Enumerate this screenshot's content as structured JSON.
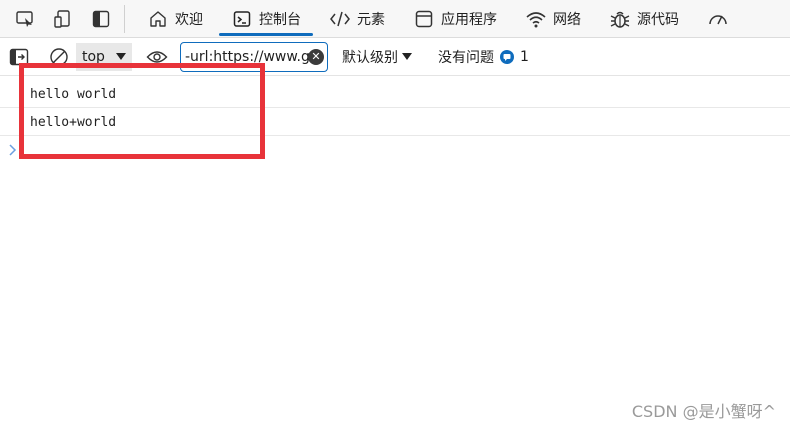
{
  "tabs": [
    {
      "label": "欢迎",
      "icon": "home-icon"
    },
    {
      "label": "控制台",
      "icon": "console-icon",
      "active": true
    },
    {
      "label": "元素",
      "icon": "code-tags-icon"
    },
    {
      "label": "应用程序",
      "icon": "app-window-icon"
    },
    {
      "label": "网络",
      "icon": "wifi-icon"
    },
    {
      "label": "源代码",
      "icon": "bug-icon"
    }
  ],
  "toolbar": {
    "context": "top",
    "filter_value": "-url:https://www.gc",
    "levels_label": "默认级别",
    "issues_label": "没有问题",
    "issues_count": "1"
  },
  "console": {
    "lines": [
      "hello world",
      "hello+world"
    ]
  },
  "watermark": "CSDN @是小蟹呀^",
  "colors": {
    "accent": "#0f6cbd",
    "highlight_box": "#e8333a"
  }
}
